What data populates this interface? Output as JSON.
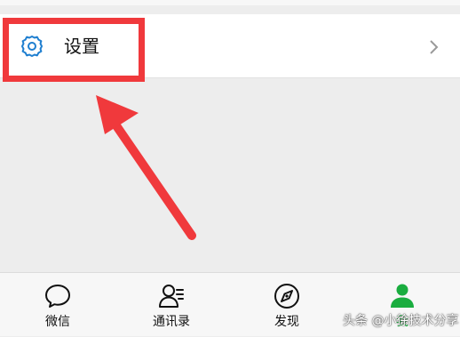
{
  "settings_row": {
    "label": "设置",
    "icon": "gear-icon"
  },
  "tabbar": {
    "tabs": [
      {
        "label": "微信",
        "icon": "chat-bubble-icon",
        "active": false
      },
      {
        "label": "通讯录",
        "icon": "contacts-icon",
        "active": false
      },
      {
        "label": "发现",
        "icon": "compass-icon",
        "active": false
      },
      {
        "label": "我",
        "icon": "person-icon",
        "active": true
      }
    ]
  },
  "watermark": "头条 @小徐技术分享",
  "colors": {
    "accent": "#1aad3f",
    "highlight": "#f0393c",
    "gear": "#1f7fd0"
  }
}
